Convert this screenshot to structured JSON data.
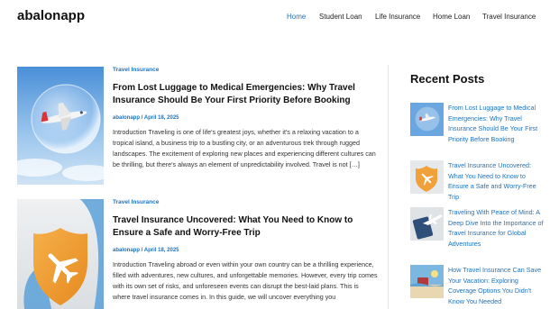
{
  "site": {
    "title": "abalonapp"
  },
  "nav": {
    "items": [
      {
        "label": "Home",
        "active": true
      },
      {
        "label": "Student Loan",
        "active": false
      },
      {
        "label": "Life Insurance",
        "active": false
      },
      {
        "label": "Home Loan",
        "active": false
      },
      {
        "label": "Travel Insurance",
        "active": false
      }
    ]
  },
  "posts": [
    {
      "category": "Travel Insurance",
      "title": "From Lost Luggage to Medical Emergencies: Why Travel Insurance Should Be Your First Priority Before Booking",
      "author": "abalonapp",
      "date": "April 18, 2025",
      "excerpt": "Introduction Traveling is one of life's greatest joys, whether it's a relaxing vacation to a tropical island, a business trip to a bustling city, or an adventurous trek through rugged landscapes. The excitement of exploring new places and experiencing different cultures can be thrilling, but there's always an element of unpredictability involved. Travel is not […]",
      "image_icon": "airplane-bubble-icon"
    },
    {
      "category": "Travel Insurance",
      "title": "Travel Insurance Uncovered: What You Need to Know to Ensure a Safe and Worry-Free Trip",
      "author": "abalonapp",
      "date": "April 18, 2025",
      "excerpt": "Introduction Traveling abroad or even within your own country can be a thrilling experience, filled with adventures, new cultures, and unforgettable memories. However, every trip comes with its own set of risks, and unforeseen events can disrupt the best-laid plans. This is where travel insurance comes in. In this guide, we will uncover everything you",
      "image_icon": "airplane-shield-icon"
    }
  ],
  "sidebar": {
    "title": "Recent Posts",
    "items": [
      {
        "label": "From Lost Luggage to Medical Emergencies: Why Travel Insurance Should Be Your First Priority Before Booking"
      },
      {
        "label": "Travel Insurance Uncovered: What You Need to Know to Ensure a Safe and Worry-Free Trip"
      },
      {
        "label": "Traveling With Peace of Mind: A Deep Dive Into the Importance of Travel Insurance for Global Adventures"
      },
      {
        "label": "How Travel Insurance Can Save Your Vacation: Exploring Coverage Options You Didn't Know You Needed"
      }
    ]
  },
  "colors": {
    "accent": "#1e73be",
    "text": "#222222"
  }
}
